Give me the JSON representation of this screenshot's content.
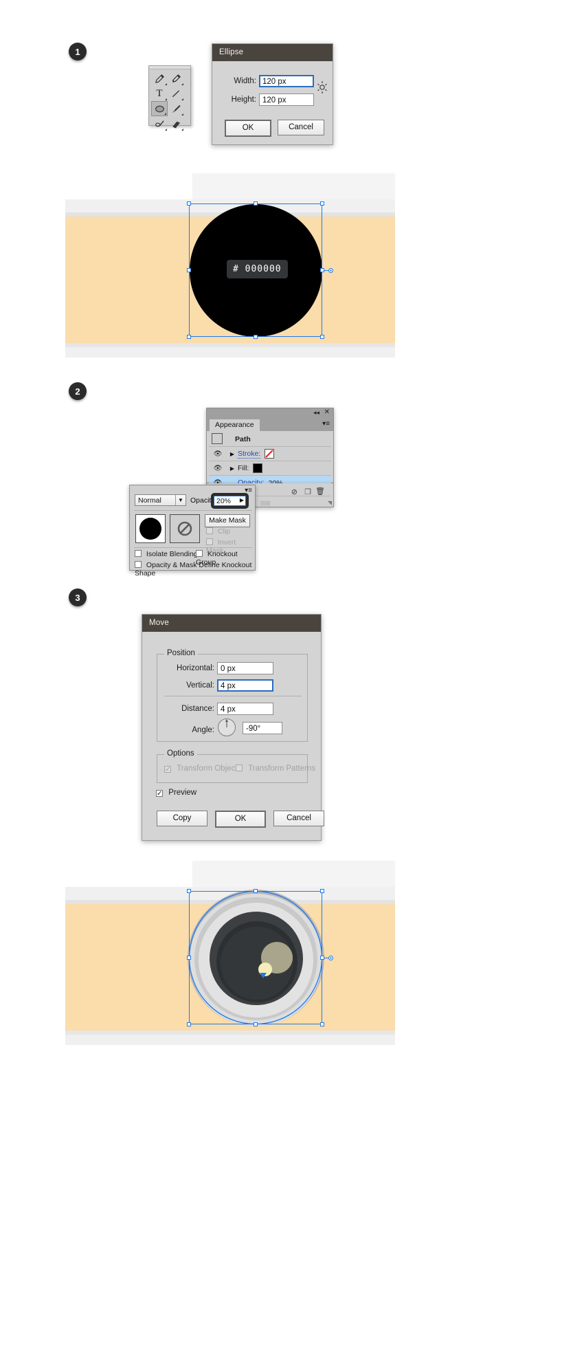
{
  "steps": [
    {
      "number": "1"
    },
    {
      "number": "2"
    },
    {
      "number": "3"
    }
  ],
  "tools_palette": {
    "name": "tools-palette",
    "items": [
      {
        "name": "pen-tool",
        "glyph": "✒",
        "selected": false
      },
      {
        "name": "add-anchor-point-tool",
        "glyph": "✒",
        "selected": false
      },
      {
        "name": "type-tool",
        "glyph": "T",
        "selected": false
      },
      {
        "name": "line-segment-tool",
        "glyph": "╱",
        "selected": false
      },
      {
        "name": "ellipse-tool",
        "glyph": "⬭",
        "selected": true
      },
      {
        "name": "paintbrush-tool",
        "glyph": "✎",
        "selected": false
      },
      {
        "name": "pencil-tool",
        "glyph": "✏",
        "selected": false
      },
      {
        "name": "eraser-tool",
        "glyph": "▱",
        "selected": false
      }
    ]
  },
  "ellipse_dialog": {
    "title": "Ellipse",
    "fields": [
      {
        "label": "Width:",
        "value": "120 px",
        "focused": true
      },
      {
        "label": "Height:",
        "value": "120 px",
        "focused": false
      }
    ],
    "constrain_icon": "constrain-proportions-icon",
    "buttons": [
      {
        "label": "OK",
        "default": true
      },
      {
        "label": "Cancel",
        "default": false
      }
    ]
  },
  "canvas_step1": {
    "hex_chip": "# 000000",
    "shape_fill": "#000000",
    "band_color": "#fbdcab",
    "body_color": "#f0f0f0",
    "selection_color": "#1f7aeb"
  },
  "appearance_panel": {
    "tab_label": "Appearance",
    "collapse_icon": "collapse-icon",
    "close_icon": "close-icon",
    "menu_icon": "panel-menu-icon",
    "object_label": "Path",
    "rows": [
      {
        "label": "Stroke:",
        "value": "",
        "swatch": "stroke-none-swatch",
        "selected": false,
        "link": true,
        "has_triangle": true,
        "eye": true
      },
      {
        "label": "Fill:",
        "value": "",
        "swatch": "fill-black-swatch",
        "selected": false,
        "link": false,
        "has_triangle": true,
        "eye": true
      },
      {
        "label": "Opacity:",
        "value": "20%",
        "swatch": "",
        "selected": true,
        "link": true,
        "has_triangle": false,
        "eye": true
      }
    ],
    "footer_icons": [
      {
        "name": "clear-appearance-icon",
        "glyph": "⃠"
      },
      {
        "name": "duplicate-item-icon",
        "glyph": "❐"
      },
      {
        "name": "delete-item-icon",
        "glyph": "🗑"
      }
    ]
  },
  "transparency_panel": {
    "menu_icon": "panel-menu-icon",
    "blend_mode": "Normal",
    "opacity_label": "Opacity:",
    "opacity_value": "20%",
    "thumbnail_name": "object-thumbnail",
    "mask_thumbnail_name": "mask-none-thumbnail",
    "make_mask_label": "Make Mask",
    "checkboxes": [
      {
        "label": "Clip",
        "checked": false,
        "disabled": true
      },
      {
        "label": "Invert Mask",
        "checked": false,
        "disabled": true
      },
      {
        "label": "Isolate Blending",
        "checked": false,
        "disabled": false
      },
      {
        "label": "Knockout Group",
        "checked": false,
        "disabled": false
      },
      {
        "label": "Opacity & Mask Define Knockout Shape",
        "checked": false,
        "disabled": false
      }
    ]
  },
  "move_dialog": {
    "title": "Move",
    "position_group": "Position",
    "fields": [
      {
        "label": "Horizontal:",
        "value": "0 px",
        "focused": false
      },
      {
        "label": "Vertical:",
        "value": "4 px",
        "focused": true
      },
      {
        "label": "Distance:",
        "value": "4 px",
        "focused": false
      },
      {
        "label": "Angle:",
        "value": "-90°",
        "focused": false
      }
    ],
    "angle_dial_name": "angle-dial",
    "options_group": "Options",
    "options": [
      {
        "label": "Transform Objects",
        "checked": true,
        "disabled": true
      },
      {
        "label": "Transform Patterns",
        "checked": false,
        "disabled": true
      }
    ],
    "preview": {
      "label": "Preview",
      "checked": true
    },
    "buttons": [
      {
        "label": "Copy",
        "default": false
      },
      {
        "label": "OK",
        "default": true
      },
      {
        "label": "Cancel",
        "default": false
      }
    ]
  },
  "canvas_step3": {
    "band_color": "#fbdcab",
    "body_color": "#f0f0f0",
    "lens_outer": "#d8d8d8",
    "lens_ring": "#c4c4c4",
    "lens_glass": "#3a3d40",
    "lens_inner": "#2b2e31",
    "highlight": "#a8a48a",
    "dot": "#f5edb8",
    "selection_color": "#1f7aeb"
  }
}
